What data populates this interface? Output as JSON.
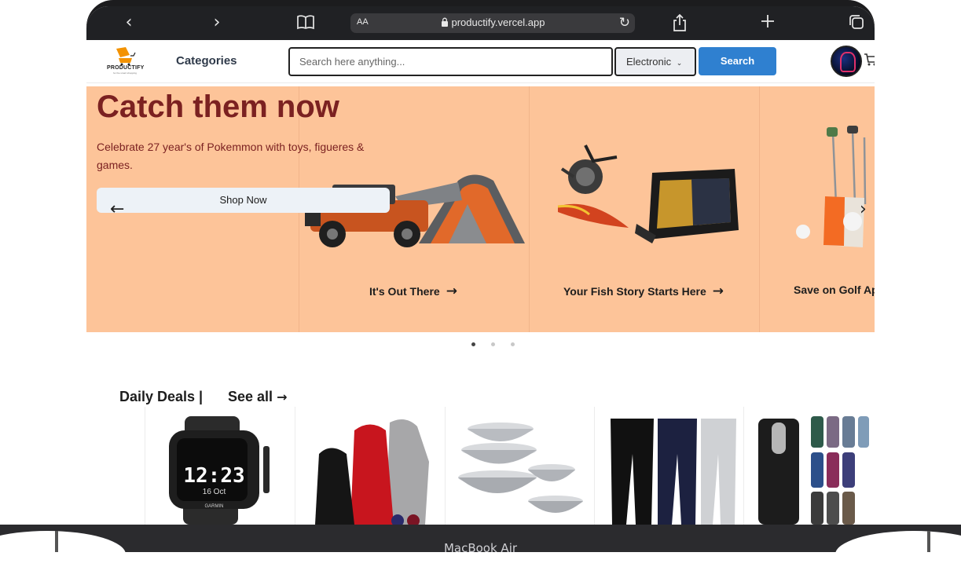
{
  "browser": {
    "url": "productify.vercel.app",
    "text_size_label": "AA"
  },
  "device": {
    "label": "MacBook Air"
  },
  "header": {
    "logo_text": "PRODUCTIFY",
    "logo_tagline": "for the smart shopping",
    "categories_label": "Categories",
    "search_placeholder": "Search here anything...",
    "selected_category": "Electronic",
    "search_button": "Search"
  },
  "hero": {
    "title": "Catch them now",
    "subtitle": "Celebrate 27 year's of Pokemmon with toys, figueres & games.",
    "cta": "Shop Now",
    "panels": [
      {
        "caption": "It's Out There"
      },
      {
        "caption": "Your Fish Story Starts Here"
      },
      {
        "caption": "Save on Golf Ap"
      }
    ],
    "slide_count": 3,
    "active_slide": 1
  },
  "deals": {
    "title": "Daily Deals |",
    "see_all": "See all",
    "items": [
      {
        "kind": "watch",
        "watch_time": "12:23",
        "watch_date": "16 Oct",
        "watch_brand": "GARMIN"
      },
      {
        "kind": "hoodies"
      },
      {
        "kind": "bowls"
      },
      {
        "kind": "joggers"
      },
      {
        "kind": "tumblers"
      }
    ]
  },
  "colors": {
    "hero_bg": "#fdc499",
    "hero_text": "#7b2121",
    "search_button": "#2f80d0",
    "toolbar": "#202124"
  },
  "icons": {
    "back": "chevron-left-icon",
    "forward": "chevron-right-icon",
    "bookmarks": "book-icon",
    "lock": "lock-icon",
    "reload": "reload-icon",
    "share": "share-icon",
    "new_tab": "plus-icon",
    "tabs": "tabs-icon",
    "cart": "cart-icon"
  }
}
